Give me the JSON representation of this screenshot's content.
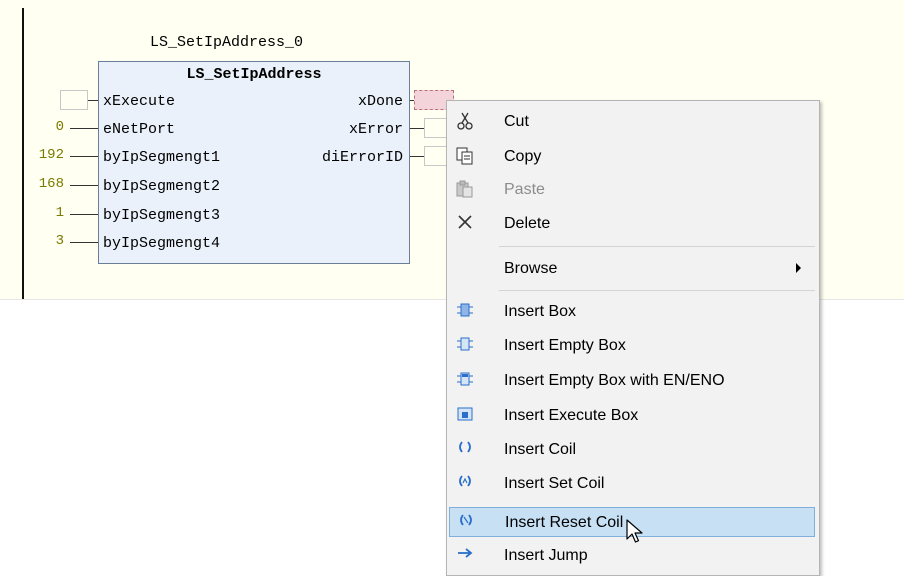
{
  "editor": {
    "instance_name": "LS_SetIpAddress_0",
    "fb_type": "LS_SetIpAddress",
    "inputs": [
      {
        "name": "xExecute",
        "value": ""
      },
      {
        "name": "eNetPort",
        "value": "0"
      },
      {
        "name": "byIpSegmengt1",
        "value": "192"
      },
      {
        "name": "byIpSegmengt2",
        "value": "168"
      },
      {
        "name": "byIpSegmengt3",
        "value": "1"
      },
      {
        "name": "byIpSegmengt4",
        "value": "3"
      }
    ],
    "outputs": [
      {
        "name": "xDone"
      },
      {
        "name": "xError"
      },
      {
        "name": "diErrorID"
      }
    ]
  },
  "context_menu": {
    "items": [
      {
        "label": "Cut",
        "icon": "scissors-icon",
        "disabled": false
      },
      {
        "label": "Copy",
        "icon": "copy-icon",
        "disabled": false
      },
      {
        "label": "Paste",
        "icon": "paste-icon",
        "disabled": true
      },
      {
        "label": "Delete",
        "icon": "delete-icon",
        "disabled": false
      },
      {
        "label": "Browse",
        "icon": "",
        "disabled": false,
        "submenu": true
      },
      {
        "label": "Insert Box",
        "icon": "insert-box-icon"
      },
      {
        "label": "Insert Empty Box",
        "icon": "insert-empty-box-icon"
      },
      {
        "label": "Insert Empty Box with EN/ENO",
        "icon": "insert-empty-box-en-eno-icon"
      },
      {
        "label": "Insert Execute Box",
        "icon": "insert-execute-box-icon"
      },
      {
        "label": "Insert Coil",
        "icon": "insert-coil-icon"
      },
      {
        "label": "Insert Set Coil",
        "icon": "insert-set-coil-icon"
      },
      {
        "label": "Insert Reset Coil",
        "icon": "insert-reset-coil-icon",
        "highlighted": true
      },
      {
        "label": "Insert Jump",
        "icon": "insert-jump-icon"
      }
    ]
  },
  "colors": {
    "editor_bg": "#fffff2",
    "fb_fill": "#eaf1fa",
    "value_text": "#7a7a00",
    "highlight": "#c7e0f4",
    "icon_blue": "#2a6fc9"
  }
}
